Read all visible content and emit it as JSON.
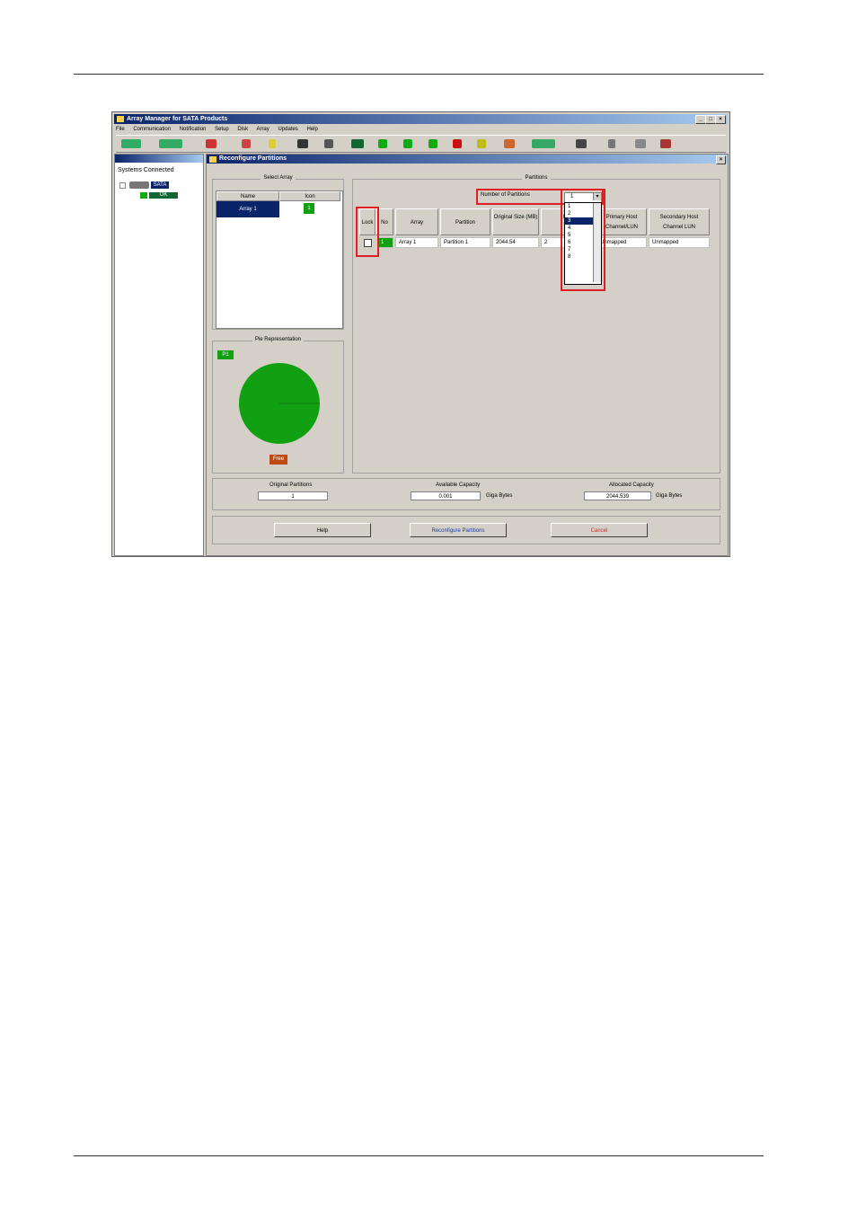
{
  "window": {
    "title": "Array Manager for SATA Products",
    "min": "_",
    "max": "□",
    "close": "×"
  },
  "menu": [
    "File",
    "Communication",
    "Notification",
    "Setup",
    "Disk",
    "Array",
    "Updates",
    "Help"
  ],
  "left_pane": {
    "title": "Systems",
    "root_label": "Systems Connected",
    "node_label": "SATA",
    "sub_label": "OK"
  },
  "dialog": {
    "title": "Reconfigure Partitions",
    "close": "×"
  },
  "select_array": {
    "legend": "Select Array",
    "columns": [
      "Name",
      "Icon"
    ],
    "rows": [
      {
        "name": "Array 1",
        "icon": "1"
      }
    ]
  },
  "pie": {
    "legend": "Pie Representation",
    "label_top": "P1",
    "label_free": "Free",
    "color": "#11a011",
    "free_color": "#c04a14"
  },
  "partitions": {
    "legend": "Partitions",
    "count_label": "Number of Partitions",
    "count_value": "1",
    "columns": [
      "Lock",
      "No",
      "Array",
      "Partition",
      "Original Size (MB)",
      "R S",
      "Primary Host Channel/LUN",
      "Secondary Host Channel LUN"
    ],
    "rows": [
      {
        "no": "1",
        "array": "Array 1",
        "partition": "Partition 1",
        "size": "2044.54",
        "rs": "2",
        "primary": "Unmapped",
        "secondary": "Unmapped"
      }
    ],
    "options": [
      "1",
      "2",
      "3",
      "4",
      "5",
      "6",
      "7",
      "8"
    ],
    "selected_option": "3"
  },
  "summary": {
    "original_label": "Original Partitions",
    "original_value": "1",
    "available_label": "Available Capacity",
    "available_value": "0.001",
    "available_unit": "Giga Bytes",
    "allocated_label": "Allocated Capacity",
    "allocated_value": "2044.539",
    "allocated_unit": "Giga Bytes"
  },
  "buttons": {
    "help": "Help",
    "reconfigure": "Reconfigure Partitions",
    "cancel": "Cancel"
  },
  "colors": {
    "highlight": "#e02020",
    "title_bar": "#0a246a",
    "green": "#11a011"
  }
}
